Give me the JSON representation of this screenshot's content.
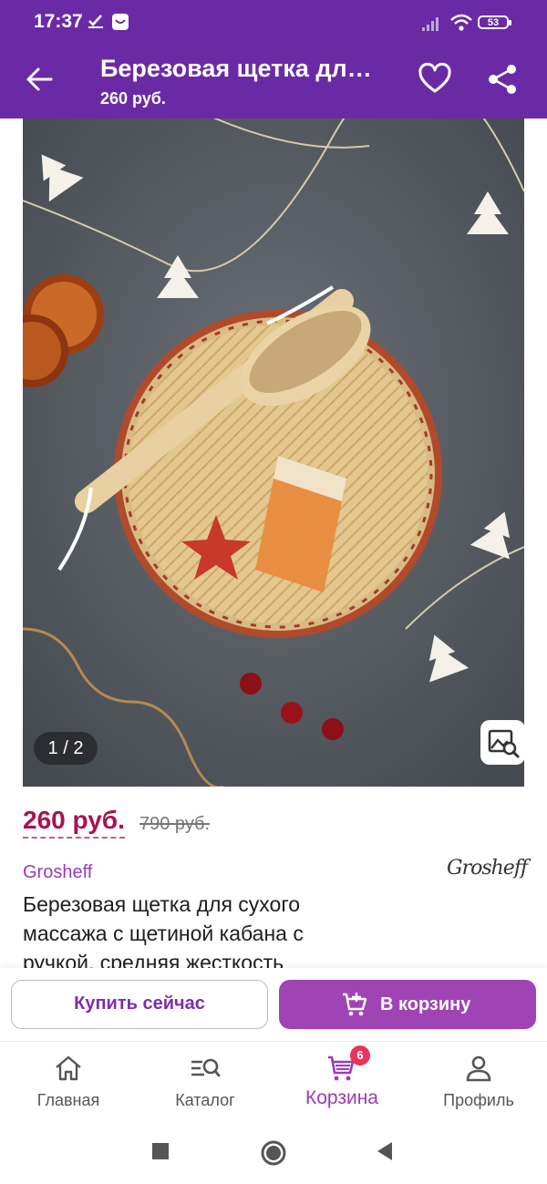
{
  "status_bar": {
    "time": "17:37",
    "battery": "53"
  },
  "app_bar": {
    "title": "Березовая щетка для сухого массажа с щетиной кабана с ручкой, средняя жесткость",
    "price": "260 руб."
  },
  "gallery": {
    "counter": "1 / 2"
  },
  "price": {
    "current": "260 руб.",
    "old": "790 руб."
  },
  "brand": {
    "name": "Grosheff",
    "logo_text": "Grosheff"
  },
  "product": {
    "title": "Березовая щетка для сухого массажа с щетиной кабана с ручкой, средняя жесткость"
  },
  "actions": {
    "buy_now": "Купить сейчас",
    "add_to_cart": "В корзину"
  },
  "bottom_nav": {
    "items": [
      {
        "label": "Главная",
        "icon": "home-icon"
      },
      {
        "label": "Каталог",
        "icon": "catalog-search-icon"
      },
      {
        "label": "Корзина",
        "icon": "cart-icon",
        "badge": "6",
        "active": true
      },
      {
        "label": "Профиль",
        "icon": "profile-icon"
      }
    ]
  },
  "colors": {
    "primary": "#6a2aa6",
    "accent": "#a043b5",
    "price": "#a8124f",
    "badge": "#e8345d"
  }
}
